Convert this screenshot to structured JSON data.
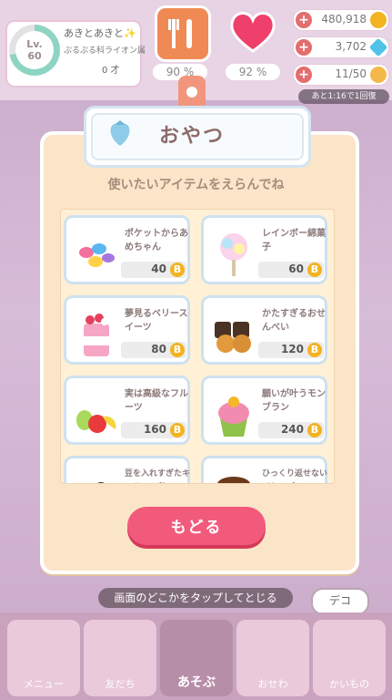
{
  "player": {
    "level_label": "Lv.",
    "level": "60",
    "name": "あきとあきと✨",
    "title": "ぷるぷる科ライオン属",
    "age": "0 才"
  },
  "status": {
    "food_pct": "90 %",
    "heart_pct": "92 %"
  },
  "resources": {
    "coins": "480,918",
    "gems": "3,702",
    "stamina": "11/50",
    "timer": "あと1:16で1回復"
  },
  "modal": {
    "title": "おやつ",
    "subtitle": "使いたいアイテムをえらんでね",
    "items": [
      {
        "name": "ポケットからあめちゃん",
        "price": "40",
        "picture": "candy-icon"
      },
      {
        "name": "レインボー綿菓子",
        "price": "60",
        "picture": "cotton-candy-icon"
      },
      {
        "name": "夢見るベリースイーツ",
        "price": "80",
        "picture": "berry-parfait-icon"
      },
      {
        "name": "かたすぎるおせんべい",
        "price": "120",
        "picture": "rice-cracker-icon"
      },
      {
        "name": "実は高級なフルーツ",
        "price": "160",
        "picture": "fruit-icon"
      },
      {
        "name": "願いが叶うモンブラン",
        "price": "240",
        "picture": "mont-blanc-icon"
      },
      {
        "name": "豆を入れすぎたキャラメル煮",
        "price": "",
        "picture": "bean-icon"
      },
      {
        "name": "ひっくり返せないバケツプリン",
        "price": "",
        "picture": "pudding-icon"
      }
    ],
    "back_label": "もどる"
  },
  "hint": "画面のどこかをタップしてとじる",
  "deco_label": "デコ",
  "nav": {
    "menu": "メニュー",
    "friends": "友だち",
    "play": "あそぶ",
    "care": "おせわ",
    "shop": "かいもの"
  },
  "colors": {
    "accent_pink": "#f25a7b",
    "coin_gold": "#f3b321",
    "modal_bg": "#fbe5c9"
  }
}
